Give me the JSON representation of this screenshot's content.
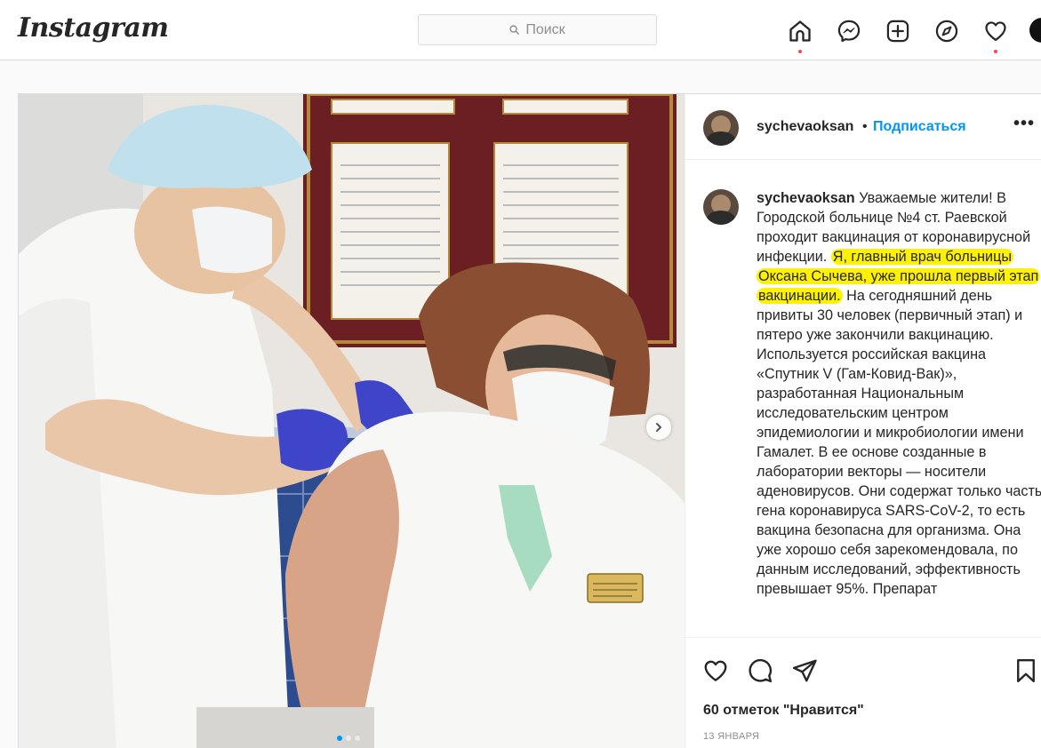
{
  "header": {
    "logo": "Instagram",
    "search_placeholder": "Поиск",
    "icons": [
      "home-icon",
      "messenger-icon",
      "new-post-icon",
      "explore-icon",
      "activity-heart-icon",
      "profile-avatar"
    ]
  },
  "post": {
    "username": "sychevaoksan",
    "separator": "•",
    "follow_label": "Подписаться",
    "more_label": "•••",
    "caption": {
      "username": "sychevaoksan",
      "text_before": "Уважаемые жители! В Городской больнице №4 ст. Раевской проходит вакцинация от коронавирусной инфекции. ",
      "text_highlight": "Я, главный врач больницы Оксана Сычева, уже прошла первый этап вакцинации.",
      "text_after": " На сегодняшний день привиты 30 человек (первичный этап) и пятеро уже закончили вакцинацию. Используется российская вакцина «Спутник V (Гам-Ковид-Вак)», разработанная Национальным исследовательским центром эпидемиологии и микробиологии имени Гамалет. В ее основе созданные в лаборатории векторы — носители аденовирусов. Они содержат только часть гена коронавируса SARS-CoV-2, то есть вакцина безопасна для организма. Она уже хорошо себя зарекомендовала, по данным исследований, эффективность превышает 95%. Препарат"
    },
    "likes_text": "60 отметок \"Нравится\"",
    "date_text": "13 января",
    "carousel": {
      "count": 3,
      "active": 1
    }
  },
  "colors": {
    "accent": "#0095f6",
    "highlight": "#fff200",
    "notification_dot": "#ed4956"
  }
}
